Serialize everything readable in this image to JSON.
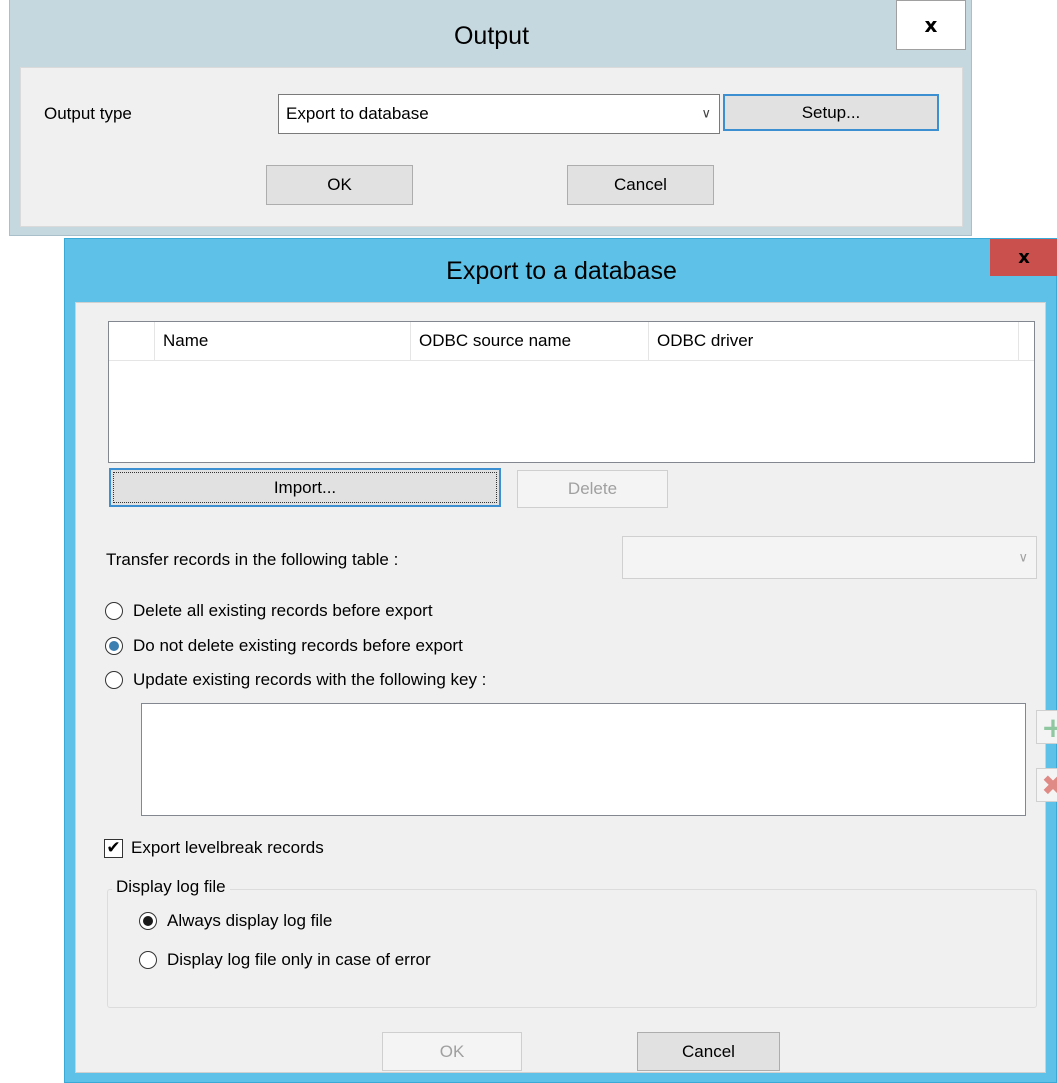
{
  "output_dialog": {
    "title": "Output",
    "close_glyph": "x",
    "output_type_label": "Output type",
    "output_type_value": "Export to database",
    "setup_label": "Setup...",
    "ok_label": "OK",
    "cancel_label": "Cancel"
  },
  "export_dialog": {
    "title": "Export to a database",
    "close_glyph": "x",
    "list_columns": [
      "Name",
      "ODBC source name",
      "ODBC driver"
    ],
    "import_label": "Import...",
    "delete_label": "Delete",
    "table_label": "Transfer records in the following table :",
    "table_value": "",
    "radio_options": [
      {
        "label": "Delete all existing records before export",
        "checked": false
      },
      {
        "label": "Do not delete existing records before export",
        "checked": true
      },
      {
        "label": "Update existing records with the following key :",
        "checked": false
      }
    ],
    "add_key_icon": "plus-icon",
    "remove_key_icon": "cross-icon",
    "levelbreak_label": "Export levelbreak records",
    "levelbreak_checked": true,
    "log_group": {
      "legend": "Display log file",
      "options": [
        {
          "label": "Always display log file",
          "checked": true
        },
        {
          "label": "Display log file only in case of error",
          "checked": false
        }
      ]
    },
    "ok_label": "OK",
    "cancel_label": "Cancel"
  },
  "colors": {
    "active_frame": "#5ec2e8",
    "inactive_frame": "#c6d8df",
    "close_active": "#c9504c",
    "radio_accent": "#3c7fb1",
    "plus_icon": "#8fc8a0",
    "cross_icon": "#e08a86"
  }
}
